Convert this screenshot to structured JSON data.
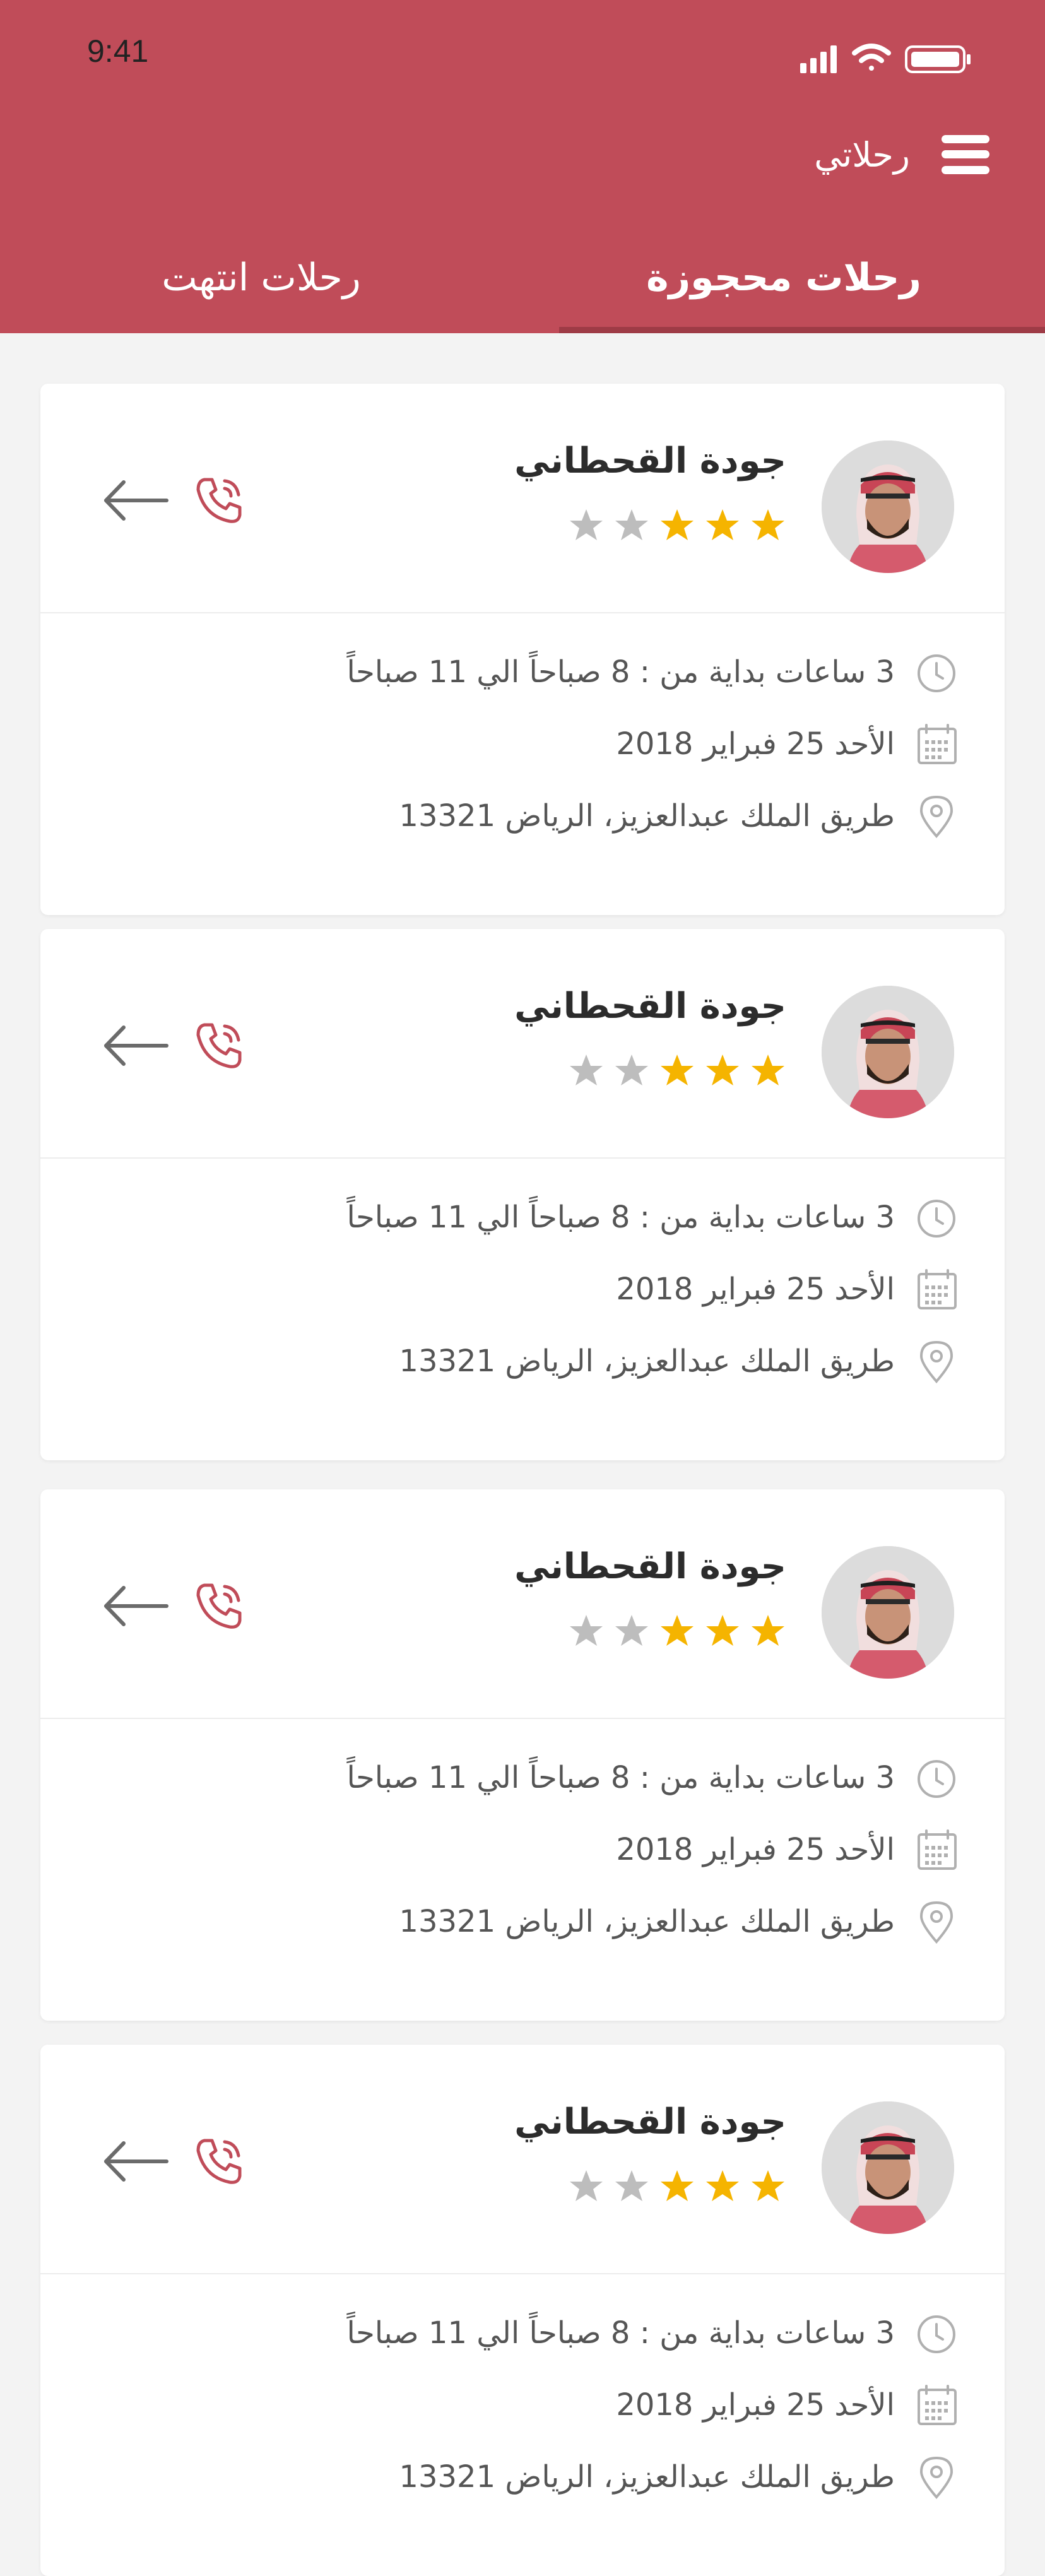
{
  "status_bar": {
    "time": "9:41"
  },
  "header": {
    "title": "رحلاتي",
    "tabs": [
      {
        "label": "رحلات محجوزة",
        "active": true
      },
      {
        "label": "رحلات انتهت",
        "active": false
      }
    ]
  },
  "colors": {
    "brand": "#c04c59",
    "tab_indicator": "#9e3b46",
    "star_active": "#f5b400",
    "star_inactive": "#bdbdbd",
    "phone_icon": "#c04c59"
  },
  "trips": [
    {
      "driver_name": "جودة القحطاني",
      "rating": 3,
      "rating_max": 5,
      "duration": "3 ساعات  بداية من : 8 صباحاً الي 11 صباحاً",
      "date": "الأحد 25 فبراير 2018",
      "address": "طريق الملك عبدالعزيز، الرياض 13321"
    },
    {
      "driver_name": "جودة القحطاني",
      "rating": 3,
      "rating_max": 5,
      "duration": "3 ساعات  بداية من : 8 صباحاً الي 11 صباحاً",
      "date": "الأحد 25 فبراير 2018",
      "address": "طريق الملك عبدالعزيز، الرياض 13321"
    },
    {
      "driver_name": "جودة القحطاني",
      "rating": 3,
      "rating_max": 5,
      "duration": "3 ساعات  بداية من : 8 صباحاً الي 11 صباحاً",
      "date": "الأحد 25 فبراير 2018",
      "address": "طريق الملك عبدالعزيز، الرياض 13321"
    },
    {
      "driver_name": "جودة القحطاني",
      "rating": 3,
      "rating_max": 5,
      "duration": "3 ساعات  بداية من : 8 صباحاً الي 11 صباحاً",
      "date": "الأحد 25 فبراير 2018",
      "address": "طريق الملك عبدالعزيز، الرياض 13321"
    }
  ]
}
